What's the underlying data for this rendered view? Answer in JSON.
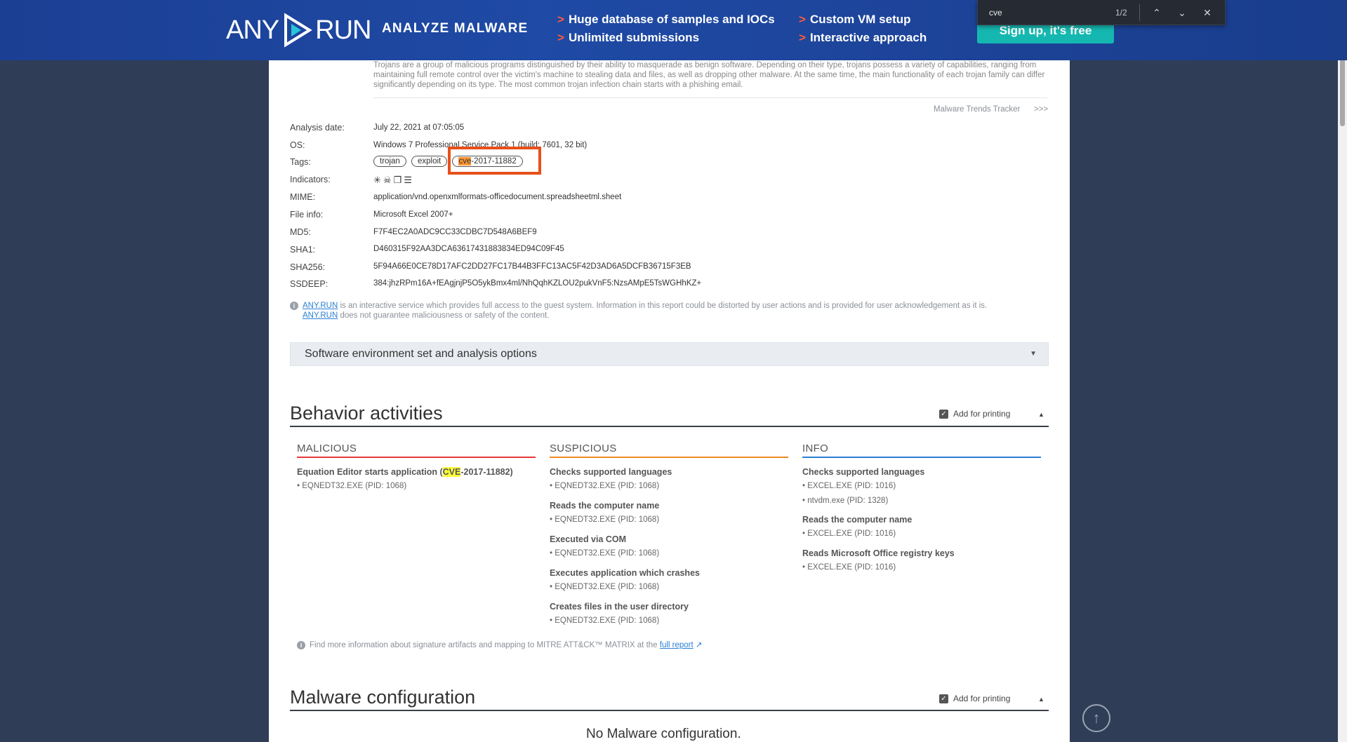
{
  "banner": {
    "logo_left": "ANY",
    "logo_right": "RUN",
    "headline": "ANALYZE MALWARE",
    "features": [
      "Huge database of samples and IOCs",
      "Unlimited submissions",
      "Custom VM setup",
      "Interactive approach"
    ],
    "signup_label": "Sign up, it's free"
  },
  "findbar": {
    "query": "cve",
    "count": "1/2",
    "up_icon": "chevron-up",
    "down_icon": "chevron-down",
    "close_icon": "close"
  },
  "description": "Trojans are a group of malicious programs distinguished by their ability to masquerade as benign software. Depending on their type, trojans possess a variety of capabilities, ranging from maintaining full remote control over the victim's machine to stealing data and files, as well as dropping other malware. At the same time, the main functionality of each trojan family can differ significantly depending on its type. The most common trojan infection chain starts with a phishing email.",
  "trends_link": "Malware Trends Tracker",
  "trends_arrow": ">>>",
  "info": {
    "analysis_date_label": "Analysis date:",
    "analysis_date": "July 22, 2021 at 07:05:05",
    "os_label": "OS:",
    "os": "Windows 7 Professional Service Pack 1 (build: 7601, 32 bit)",
    "tags_label": "Tags:",
    "tags": [
      "trojan",
      "exploit"
    ],
    "cve_tag_match": "cve",
    "cve_tag_rest": "-2017-11882",
    "indicators_label": "Indicators:",
    "indicators_icons": [
      "spark-icon",
      "skull-icon",
      "copy-icon",
      "list-icon"
    ],
    "mime_label": "MIME:",
    "mime": "application/vnd.openxmlformats-officedocument.spreadsheetml.sheet",
    "fileinfo_label": "File info:",
    "fileinfo": "Microsoft Excel 2007+",
    "md5_label": "MD5:",
    "md5": "F7F4EC2A0ADC9CC33CDBC7D548A6BEF9",
    "sha1_label": "SHA1:",
    "sha1": "D460315F92AA3DCA63617431883834ED94C09F45",
    "sha256_label": "SHA256:",
    "sha256": "5F94A66E0CE78D17AFC2DD27FC17B44B3FFC13AC5F42D3AD6A5DCFB36715F3EB",
    "ssdeep_label": "SSDEEP:",
    "ssdeep": "384:jhzRPm16A+fEAgjnjP5O5ykBmx4ml/NhQqhKZLOU2pukVnF5:NzsAMpE5TsWGHhKZ+"
  },
  "notice": {
    "link1": "ANY.RUN",
    "text1": "is an interactive service which provides full access to the guest system. Information in this report could be distorted by user actions and is provided for user acknowledgement as it is.",
    "link2": "ANY.RUN",
    "text2": "does not guarantee maliciousness or safety of the content."
  },
  "software_env": "Software environment set and analysis options",
  "behavior": {
    "title": "Behavior activities",
    "print_label": "Add for printing",
    "malicious": {
      "header": "MALICIOUS",
      "title_pre": "Equation Editor starts application (",
      "title_match": "CVE",
      "title_post": "-2017-11882)",
      "proc": "EQNEDT32.EXE (PID: 1068)"
    },
    "suspicious": {
      "header": "SUSPICIOUS",
      "items": [
        {
          "title": "Checks supported languages",
          "procs": [
            "EQNEDT32.EXE (PID: 1068)"
          ]
        },
        {
          "title": "Reads the computer name",
          "procs": [
            "EQNEDT32.EXE (PID: 1068)"
          ]
        },
        {
          "title": "Executed via COM",
          "procs": [
            "EQNEDT32.EXE (PID: 1068)"
          ]
        },
        {
          "title": "Executes application which crashes",
          "procs": [
            "EQNEDT32.EXE (PID: 1068)"
          ]
        },
        {
          "title": "Creates files in the user directory",
          "procs": [
            "EQNEDT32.EXE (PID: 1068)"
          ]
        }
      ]
    },
    "info": {
      "header": "INFO",
      "items": [
        {
          "title": "Checks supported languages",
          "procs": [
            "EXCEL.EXE (PID: 1016)",
            "ntvdm.exe (PID: 1328)"
          ]
        },
        {
          "title": "Reads the computer name",
          "procs": [
            "EXCEL.EXE (PID: 1016)"
          ]
        },
        {
          "title": "Reads Microsoft Office registry keys",
          "procs": [
            "EXCEL.EXE (PID: 1016)"
          ]
        }
      ]
    },
    "findmore_text": "Find more information about signature artifacts and mapping to MITRE ATT&CK™ MATRIX at the",
    "findmore_link": "full report"
  },
  "malware_config": {
    "title": "Malware configuration",
    "print_label": "Add for printing",
    "empty": "No Malware configuration."
  },
  "colors": {
    "malicious": "#e53935",
    "suspicious": "#f08a24",
    "info": "#2a7fd4",
    "find_current": "#ff9632",
    "find_other": "#ffff38"
  }
}
